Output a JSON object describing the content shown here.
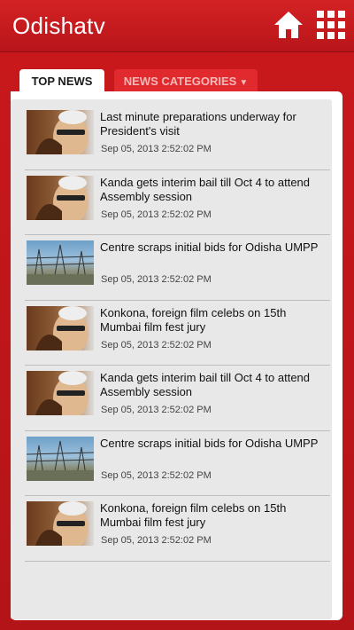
{
  "app": {
    "logo": "Odishatv"
  },
  "header": {
    "home_icon": "home-icon",
    "menu_icon": "grid-menu-icon",
    "accent": "#c41a1c"
  },
  "tabs": [
    {
      "label": "TOP NEWS"
    },
    {
      "label": "NEWS CATEGORIES"
    }
  ],
  "news": [
    {
      "title": "Last minute preparations underway for President's visit",
      "date": "Sep 05, 2013 2:52:02 PM",
      "thumb": "portrait"
    },
    {
      "title": "Kanda gets interim bail till Oct 4 to attend Assembly session",
      "date": "Sep 05, 2013 2:52:02 PM",
      "thumb": "portrait"
    },
    {
      "title": "Centre scraps initial bids for Odisha UMPP",
      "date": "Sep 05, 2013 2:52:02 PM",
      "thumb": "infra"
    },
    {
      "title": "Konkona, foreign film celebs on 15th Mumbai film fest jury",
      "date": "Sep 05, 2013 2:52:02 PM",
      "thumb": "portrait"
    },
    {
      "title": "Kanda gets interim bail till Oct 4 to attend Assembly session",
      "date": "Sep 05, 2013 2:52:02 PM",
      "thumb": "portrait"
    },
    {
      "title": "Centre scraps initial bids for Odisha UMPP",
      "date": "Sep 05, 2013 2:52:02 PM",
      "thumb": "infra"
    },
    {
      "title": "Konkona, foreign film celebs on 15th Mumbai film fest jury",
      "date": "Sep 05, 2013 2:52:02 PM",
      "thumb": "portrait"
    }
  ]
}
